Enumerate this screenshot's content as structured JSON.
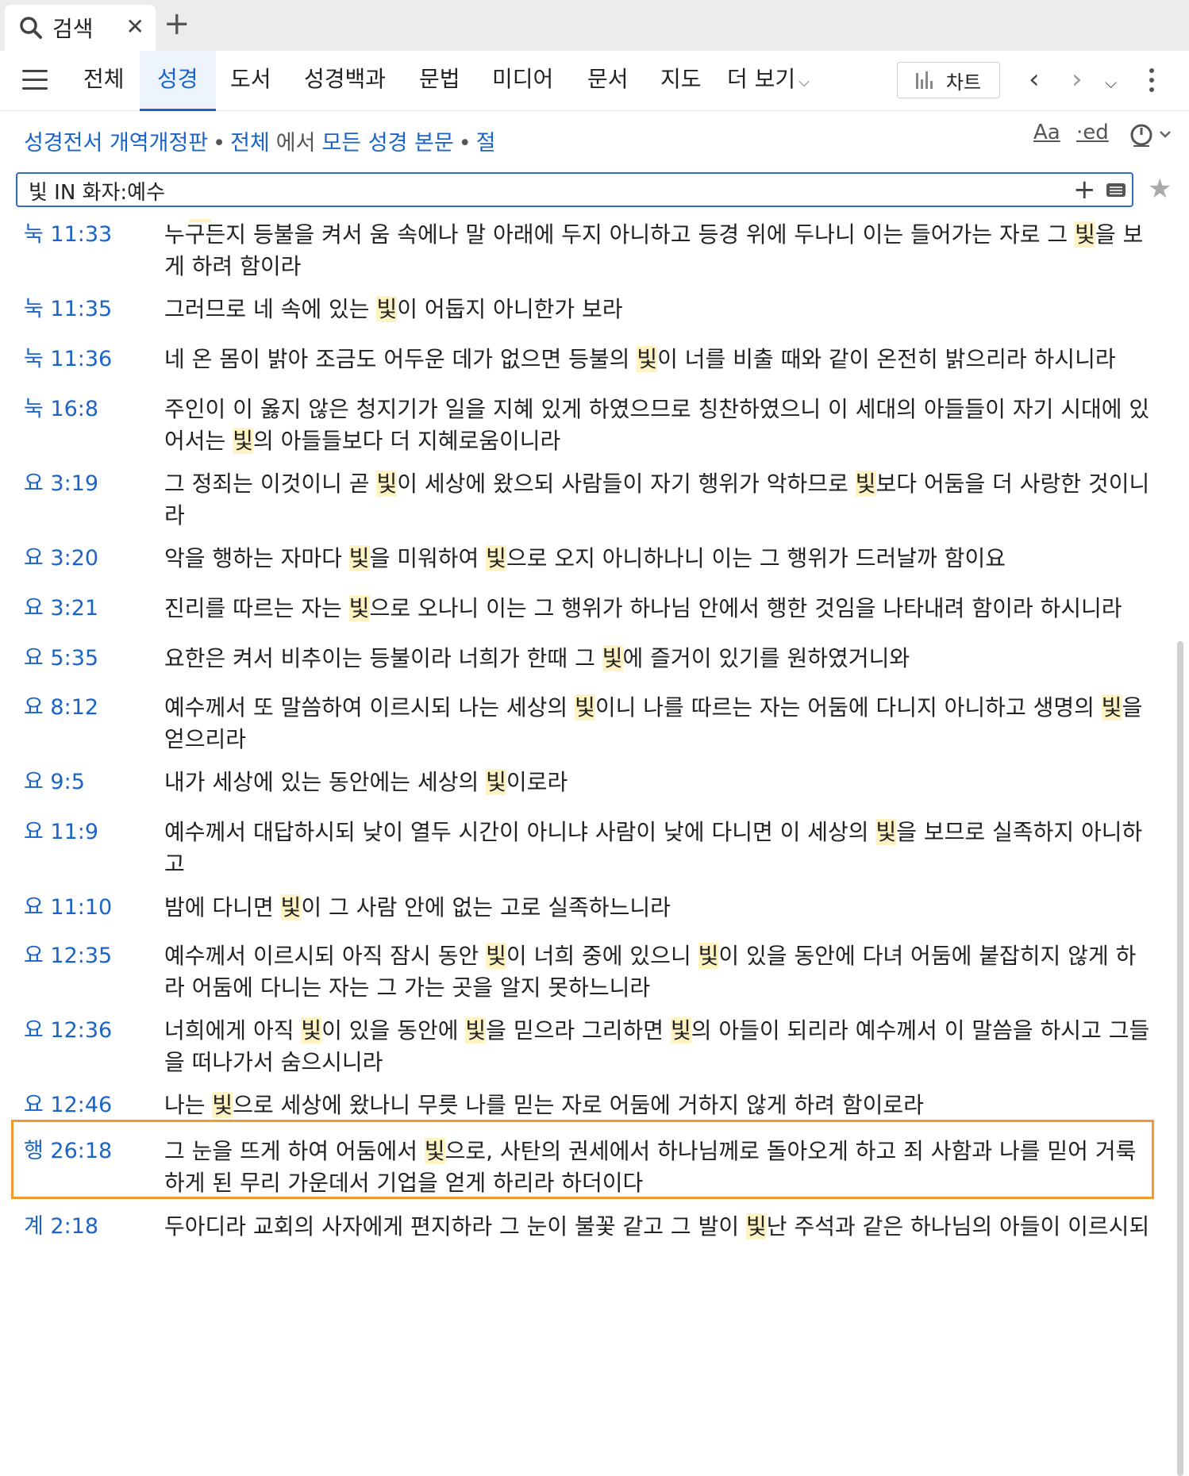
{
  "tab": {
    "label": "검색",
    "icon": "search-icon"
  },
  "nav": {
    "items": [
      "전체",
      "성경",
      "도서",
      "성경백과",
      "문법",
      "미디어",
      "문서",
      "지도",
      "더 보기"
    ],
    "active": "성경",
    "chart_label": "차트"
  },
  "breadcrumb": {
    "resource": "성경전서 개역개정판",
    "scope": "전체",
    "in_word": "에서",
    "target": "모든 성경 본문",
    "unit": "절"
  },
  "tools": {
    "font": "Aa",
    "ed": "·ed"
  },
  "search": {
    "query": "빛 IN 화자:예수"
  },
  "colors": {
    "link": "#1a64c8",
    "highlight": "#fff3c4",
    "selection": "#f29a30"
  },
  "verses": [
    {
      "ref": "눅 11:33",
      "text": "누구든지 등불을 켜서 움 속에나 말 아래에 두지 아니하고 등경 위에 두나니 이는 들어가는 자로 그 빛을 보게 하려 함이라"
    },
    {
      "ref": "눅 11:35",
      "text": "그러므로 네 속에 있는 빛이 어둡지 아니한가 보라"
    },
    {
      "ref": "눅 11:36",
      "text": "네 온 몸이 밝아 조금도 어두운 데가 없으면 등불의 빛이 너를 비출 때와 같이 온전히 밝으리라 하시니라"
    },
    {
      "ref": "눅 16:8",
      "text": "주인이 이 옳지 않은 청지기가 일을 지혜 있게 하였으므로 칭찬하였으니 이 세대의 아들들이 자기 시대에 있어서는 빛의 아들들보다 더 지혜로움이니라"
    },
    {
      "ref": "요 3:19",
      "text": "그 정죄는 이것이니 곧 빛이 세상에 왔으되 사람들이 자기 행위가 악하므로 빛보다 어둠을 더 사랑한 것이니라"
    },
    {
      "ref": "요 3:20",
      "text": "악을 행하는 자마다 빛을 미워하여 빛으로 오지 아니하나니 이는 그 행위가 드러날까 함이요"
    },
    {
      "ref": "요 3:21",
      "text": "진리를 따르는 자는 빛으로 오나니 이는 그 행위가 하나님 안에서 행한 것임을 나타내려 함이라 하시니라"
    },
    {
      "ref": "요 5:35",
      "text": "요한은 켜서 비추이는 등불이라 너희가 한때 그 빛에 즐거이 있기를 원하였거니와"
    },
    {
      "ref": "요 8:12",
      "text": "예수께서 또 말씀하여 이르시되 나는 세상의 빛이니 나를 따르는 자는 어둠에 다니지 아니하고 생명의 빛을 얻으리라"
    },
    {
      "ref": "요 9:5",
      "text": "내가 세상에 있는 동안에는 세상의 빛이로라"
    },
    {
      "ref": "요 11:9",
      "text": "예수께서 대답하시되 낮이 열두 시간이 아니냐 사람이 낮에 다니면 이 세상의 빛을 보므로 실족하지 아니하고"
    },
    {
      "ref": "요 11:10",
      "text": "밤에 다니면 빛이 그 사람 안에 없는 고로 실족하느니라"
    },
    {
      "ref": "요 12:35",
      "text": "예수께서 이르시되 아직 잠시 동안 빛이 너희 중에 있으니 빛이 있을 동안에 다녀 어둠에 붙잡히지 않게 하라 어둠에 다니는 자는 그 가는 곳을 알지 못하느니라"
    },
    {
      "ref": "요 12:36",
      "text": "너희에게 아직 빛이 있을 동안에 빛을 믿으라 그리하면 빛의 아들이 되리라 예수께서 이 말씀을 하시고 그들을 떠나가서 숨으시니라"
    },
    {
      "ref": "요 12:46",
      "text": "나는 빛으로 세상에 왔나니 무릇 나를 믿는 자로 어둠에 거하지 않게 하려 함이로라"
    },
    {
      "ref": "행 26:18",
      "text": "그 눈을 뜨게 하여 어둠에서 빛으로, 사탄의 권세에서 하나님께로 돌아오게 하고 죄 사함과 나를 믿어 거룩하게 된 무리 가운데서 기업을 얻게 하리라 하더이다",
      "selected": true
    },
    {
      "ref": "계 2:18",
      "text": "두아디라 교회의 사자에게 편지하라 그 눈이 불꽃 같고 그 발이 빛난 주석과 같은 하나님의 아들이 이르시되"
    }
  ]
}
